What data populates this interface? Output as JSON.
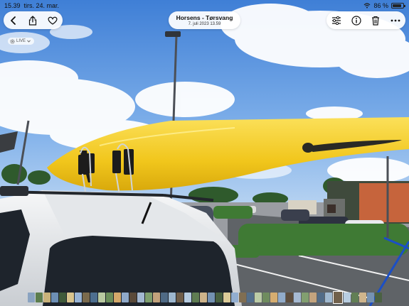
{
  "status_bar": {
    "time": "15.39",
    "date": "tirs. 24. mar.",
    "battery": "86 %",
    "battery_level": 0.86
  },
  "header": {
    "back_icon": "chevron-left-icon",
    "share_icon": "share-icon",
    "favorite_icon": "heart-icon",
    "title": "Horsens - Tørsvang",
    "subtitle": "7. juli 2023  13.59",
    "adjust_icon": "sliders-icon",
    "info_icon": "info-icon",
    "delete_icon": "trash-icon",
    "more_icon": "ellipsis-icon"
  },
  "live_badge": {
    "label": "LIVE",
    "icon": "live-photo-icon"
  },
  "filmstrip": {
    "thumbnail_colors": [
      "#8aa3c1",
      "#5c7d4e",
      "#c9b27a",
      "#6d8fb5",
      "#3f5a3a",
      "#d9c58e",
      "#98b4d6",
      "#7a6a4d",
      "#4d6e8f",
      "#b9c9a1",
      "#6b8e5a",
      "#d4a86a",
      "#8fa9c9",
      "#5a4a3a",
      "#a3b8d1",
      "#7f9f6e",
      "#c2a27c",
      "#4f6a85",
      "#9db7cf",
      "#6e5c48",
      "#b6cbe0",
      "#5f7c52",
      "#cdb38a",
      "#7391b2",
      "#475f3f",
      "#dccb98",
      "#92aed0",
      "#806e52",
      "#536f8c",
      "#bccca6",
      "#6f8c5e",
      "#d6ad70",
      "#91abc9",
      "#5d4d3d",
      "#a6bad3",
      "#829f70",
      "#c4a47e",
      "#526c87",
      "#a0b9d0",
      "#70604b",
      "#b8cde1",
      "#627f55",
      "#cfb58c",
      "#7592b3",
      "#4a6142"
    ],
    "current_index": 39
  }
}
